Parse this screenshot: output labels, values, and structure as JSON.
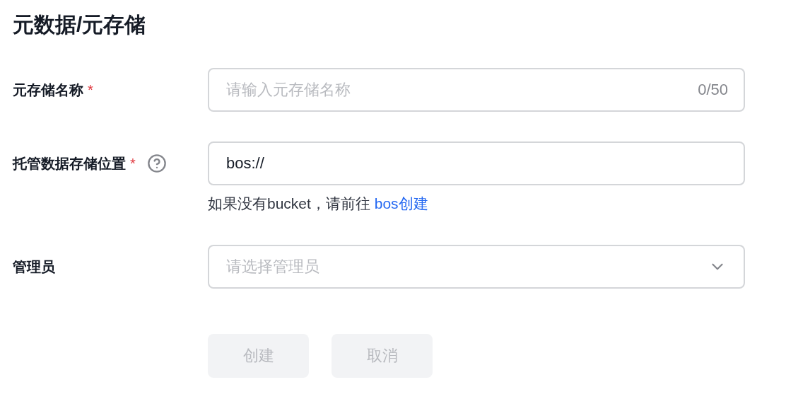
{
  "title": "元数据/元存储",
  "fields": [
    {
      "kind": "text",
      "label": "元存储名称",
      "required_mark": "*",
      "placeholder": "请输入元存储名称",
      "counter": "0/50"
    },
    {
      "kind": "text",
      "label": "托管数据存储位置",
      "required_mark": "*",
      "help": true,
      "value": "bos://",
      "hint": "如果没有bucket，请前往 ",
      "hint_link": "bos创建"
    },
    {
      "kind": "select",
      "label": "管理员",
      "placeholder": "请选择管理员"
    }
  ],
  "buttons": [
    {
      "label": "创建",
      "disabled": true
    },
    {
      "label": "取消",
      "disabled": true
    }
  ]
}
